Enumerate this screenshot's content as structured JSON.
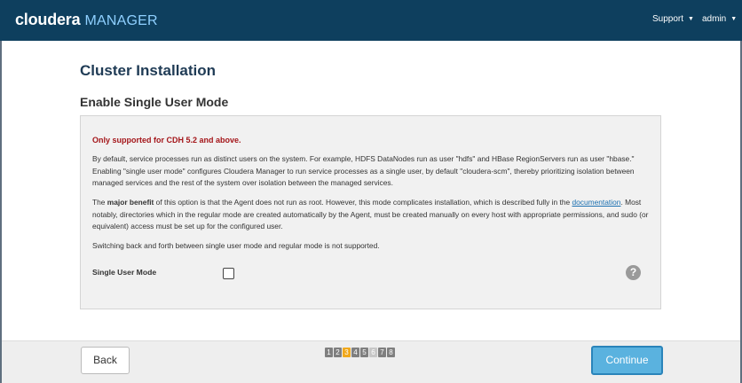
{
  "header": {
    "brand_main": "cloudera",
    "brand_sub": "MANAGER",
    "support_label": "Support",
    "admin_label": "admin"
  },
  "page": {
    "title": "Cluster Installation",
    "section_title": "Enable Single User Mode"
  },
  "panel": {
    "warning": "Only supported for CDH 5.2 and above.",
    "paragraph1": "By default, service processes run as distinct users on the system. For example, HDFS DataNodes run as user \"hdfs\" and HBase RegionServers run as user \"hbase.\" Enabling \"single user mode\" configures Cloudera Manager to run service processes as a single user, by default \"cloudera-scm\", thereby prioritizing isolation between managed services and the rest of the system over isolation between the managed services.",
    "paragraph2_prefix": "The ",
    "paragraph2_bold": "major benefit",
    "paragraph2_mid": " of this option is that the Agent does not run as root. However, this mode complicates installation, which is described fully in the ",
    "paragraph2_link": "documentation",
    "paragraph2_suffix": ". Most notably, directories which in the regular mode are created automatically by the Agent, must be created manually on every host with appropriate permissions, and sudo (or equivalent) access must be set up for the configured user.",
    "paragraph3": "Switching back and forth between single user mode and regular mode is not supported.",
    "single_user_label": "Single User Mode",
    "single_user_checked": false,
    "help_glyph": "?"
  },
  "footer": {
    "back_label": "Back",
    "continue_label": "Continue",
    "steps": [
      "1",
      "2",
      "3",
      "4",
      "5",
      "6",
      "7",
      "8"
    ],
    "current_step": "3"
  },
  "icons": {
    "caret": "caret-down-icon",
    "help": "question-circle-icon"
  },
  "colors": {
    "topbar": "#0e3f5e",
    "brand_sub": "#8fd0ff",
    "warning": "#a4161a",
    "step_active": "#f0a81c",
    "continue": "#5ab2df"
  }
}
